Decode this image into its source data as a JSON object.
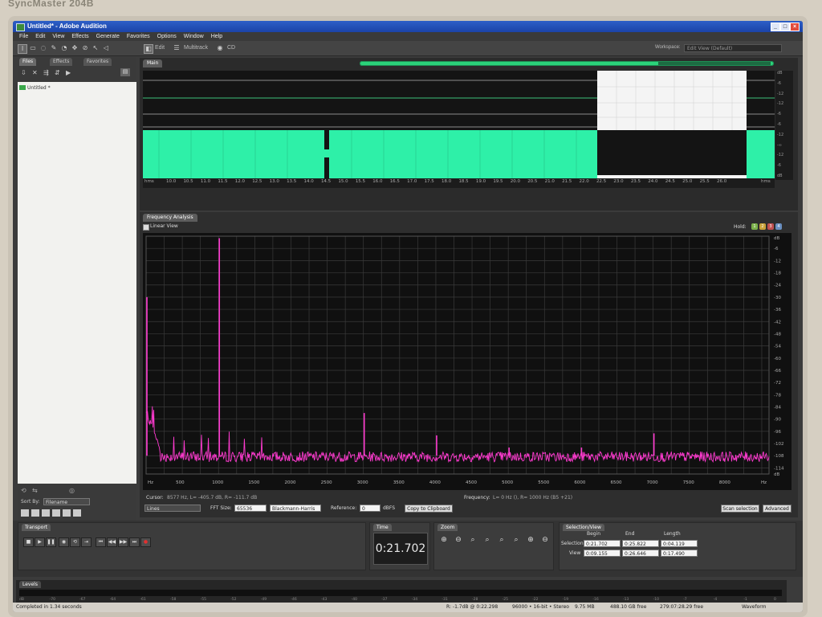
{
  "monitor": {
    "brand": "SyncMaster 204B"
  },
  "window": {
    "title": "Untitled* - Adobe Audition",
    "min": "_",
    "max": "□",
    "close": "×"
  },
  "menu": [
    "File",
    "Edit",
    "View",
    "Effects",
    "Generate",
    "Favorites",
    "Options",
    "Window",
    "Help"
  ],
  "toolbar": {
    "edit_label": "Edit",
    "multitrack_label": "Multitrack",
    "cd_label": "CD",
    "workspace_label": "Workspace:",
    "workspace_value": "Edit View (Default)"
  },
  "files_panel": {
    "tabs": [
      "Files",
      "Effects",
      "Favorites"
    ],
    "items": [
      "Untitled *"
    ],
    "sort_by_label": "Sort By:",
    "sort_by_value": "Filename"
  },
  "main_panel": {
    "tab": "Main",
    "ruler_start": "hms",
    "ruler_end": "hms",
    "ruler_ticks": [
      "10.0",
      "10.5",
      "11.0",
      "11.5",
      "12.0",
      "12.5",
      "13.0",
      "13.5",
      "14.0",
      "14.5",
      "15.0",
      "15.5",
      "16.0",
      "16.5",
      "17.0",
      "17.5",
      "18.0",
      "18.5",
      "19.0",
      "19.5",
      "20.0",
      "20.5",
      "21.0",
      "21.5",
      "22.0",
      "22.5",
      "23.0",
      "23.5",
      "24.0",
      "24.5",
      "25.0",
      "25.5",
      "26.0"
    ],
    "db_ticks": [
      "dB",
      "-6",
      "-12",
      "-12",
      "-6",
      "-6",
      "-12",
      "-∞",
      "-12",
      "-6",
      "dB"
    ]
  },
  "frequency_analysis": {
    "tab": "Frequency Analysis",
    "linear_view_label": "Linear View",
    "hold_label": "Hold:",
    "hold_buttons": [
      "1",
      "2",
      "3",
      "4"
    ],
    "cursor_label": "Cursor:",
    "cursor_value": "8577 Hz, L= -405.7 dB, R= -111.7 dB",
    "frequency_label": "Frequency:",
    "frequency_value": "L=    0 Hz (), R=   1000 Hz (B5 +21)",
    "display_mode": "Lines",
    "fft_size_label": "FFT Size:",
    "fft_size": "65536",
    "window_fn": "Blackmann-Harris",
    "reference_label": "Reference:",
    "reference_value": "0",
    "reference_unit": "dBFS",
    "copy_button": "Copy to Clipboard",
    "scan_button": "Scan selection",
    "advanced_button": "Advanced"
  },
  "chart_data": {
    "type": "line",
    "x_unit": "Hz",
    "y_unit": "dB",
    "x_ticks": [
      "Hz",
      "500",
      "1000",
      "1500",
      "2000",
      "2500",
      "3000",
      "3500",
      "4000",
      "4500",
      "5000",
      "5500",
      "6000",
      "6500",
      "7000",
      "7500",
      "8000",
      "Hz"
    ],
    "y_ticks": [
      "dB",
      "-6",
      "-12",
      "-18",
      "-24",
      "-30",
      "-36",
      "-42",
      "-48",
      "-54",
      "-60",
      "-66",
      "-72",
      "-78",
      "-84",
      "-90",
      "-96",
      "-102",
      "-108",
      "-114",
      "dB"
    ],
    "xlim": [
      0,
      8600
    ],
    "ylim": [
      -117,
      0
    ],
    "noise_floor_db": -108,
    "peaks": [
      {
        "x": 0,
        "y": -30
      },
      {
        "x": 1000,
        "y": -1
      },
      {
        "x": 3000,
        "y": -87
      },
      {
        "x": 4000,
        "y": -98
      },
      {
        "x": 5000,
        "y": -104
      },
      {
        "x": 6000,
        "y": -104
      },
      {
        "x": 7000,
        "y": -97
      }
    ],
    "grid": true,
    "line_color": "#ff3ad0"
  },
  "transport": {
    "tab": "Transport"
  },
  "time": {
    "tab": "Time",
    "value": "0:21.702"
  },
  "zoom": {
    "tab": "Zoom"
  },
  "selection_view": {
    "tab": "Selection/View",
    "headers": [
      "Begin",
      "End",
      "Length"
    ],
    "rows": [
      {
        "label": "Selection",
        "begin": "0:21.702",
        "end": "0:25.822",
        "length": "0:04.119"
      },
      {
        "label": "View",
        "begin": "0:09.155",
        "end": "0:26.646",
        "length": "0:17.490"
      }
    ]
  },
  "levels": {
    "tab": "Levels",
    "scale": [
      "dB",
      "-70",
      "-67",
      "-64",
      "-61",
      "-58",
      "-55",
      "-52",
      "-49",
      "-46",
      "-43",
      "-40",
      "-37",
      "-34",
      "-31",
      "-28",
      "-25",
      "-22",
      "-19",
      "-16",
      "-13",
      "-10",
      "-7",
      "-4",
      "-1",
      "0"
    ]
  },
  "status": {
    "left": "Completed in 1.34 seconds",
    "r_db": "R: -1.7dB @  0:22.298",
    "format": "96000 • 16-bit • Stereo",
    "file_size": "9.75 MB",
    "free_space": "488.10 GB free",
    "free_time": "279:07:28.29 free",
    "view": "Waveform"
  },
  "colors": {
    "waveform": "#2ef0a8",
    "spectrum": "#ff3ad0",
    "panel": "#3a3a3a",
    "titlebar": "#1b43a8"
  }
}
